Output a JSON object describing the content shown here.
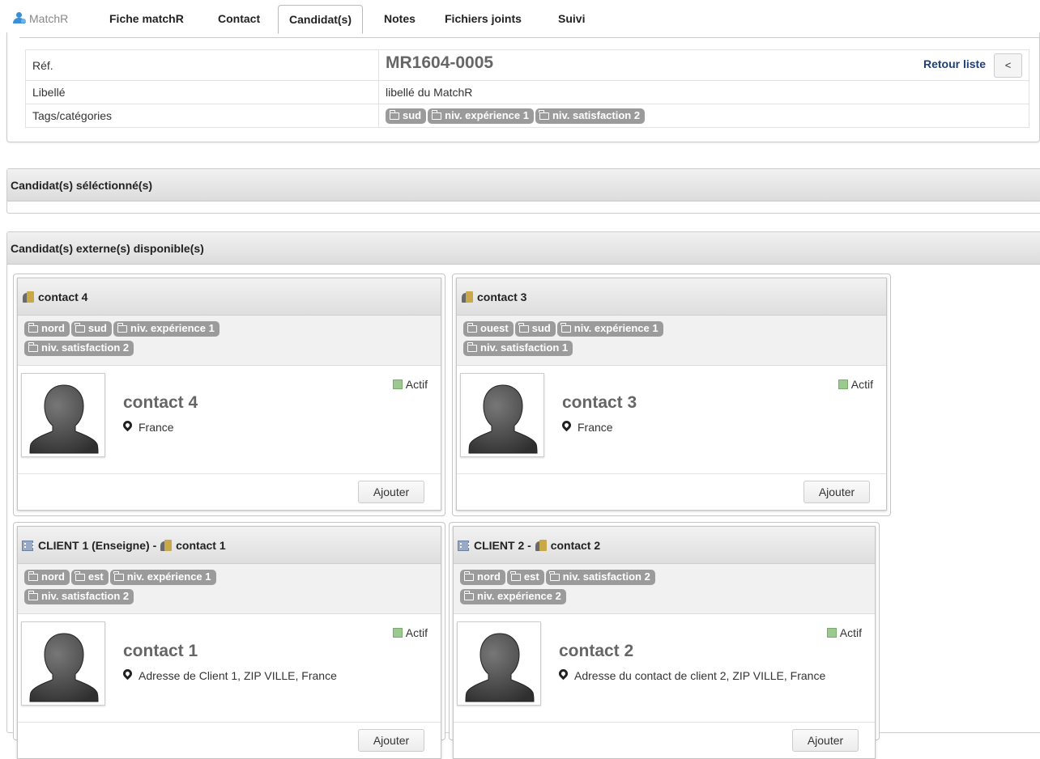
{
  "tabs": [
    {
      "label": "MatchR"
    },
    {
      "label": "Fiche matchR"
    },
    {
      "label": "Contact"
    },
    {
      "label": "Candidat(s)"
    },
    {
      "label": "Notes"
    },
    {
      "label": "Fichiers joints"
    },
    {
      "label": "Suivi"
    }
  ],
  "active_tab": "Candidat(s)",
  "info": {
    "ref_label": "Réf.",
    "ref_value": "MR1604-0005",
    "retour_label": "Retour liste",
    "back_label": "<",
    "libelle_label": "Libellé",
    "libelle_value": "libellé du MatchR",
    "tags_label": "Tags/catégories",
    "tags": [
      "sud",
      "niv. expérience 1",
      "niv. satisfaction 2"
    ]
  },
  "sections": {
    "selected_title": "Candidat(s) séléctionné(s)",
    "available_title": "Candidat(s) externe(s) disponible(s)"
  },
  "cards": [
    {
      "client": "",
      "separator": "",
      "contact": "contact 4",
      "tags_row1": [
        "nord",
        "sud",
        "niv. expérience 1"
      ],
      "tags_row2": [
        "niv. satisfaction 2"
      ],
      "name": "contact 4",
      "address": "France",
      "status": "Actif",
      "button": "Ajouter"
    },
    {
      "client": "",
      "separator": "",
      "contact": "contact 3",
      "tags_row1": [
        "ouest",
        "sud",
        "niv. expérience 1"
      ],
      "tags_row2": [
        "niv. satisfaction 1"
      ],
      "name": "contact 3",
      "address": "France",
      "status": "Actif",
      "button": "Ajouter"
    },
    {
      "client": "CLIENT 1 (Enseigne)",
      "separator": " - ",
      "contact": "contact 1",
      "tags_row1": [
        "nord",
        "est",
        "niv. expérience 1"
      ],
      "tags_row2": [
        "niv. satisfaction 2"
      ],
      "name": "contact 1",
      "address": "Adresse de Client 1, ZIP VILLE, France",
      "status": "Actif",
      "button": "Ajouter"
    },
    {
      "client": "CLIENT 2",
      "separator": " - ",
      "contact": "contact 2",
      "tags_row1": [
        "nord",
        "est",
        "niv. satisfaction 2"
      ],
      "tags_row2": [
        "niv. expérience 2"
      ],
      "name": "contact 2",
      "address": "Adresse du contact de client 2, ZIP VILLE, France",
      "status": "Actif",
      "button": "Ajouter"
    }
  ],
  "colors": {
    "tag_bg": "#9b9b9b",
    "active_square": "#9cc98f",
    "link": "#1f3f7a",
    "user_icon": "#3a8fd6"
  },
  "icons": [
    "user-icon",
    "folder-icon",
    "person-card-icon",
    "building-icon",
    "map-marker-icon",
    "avatar-silhouette"
  ]
}
